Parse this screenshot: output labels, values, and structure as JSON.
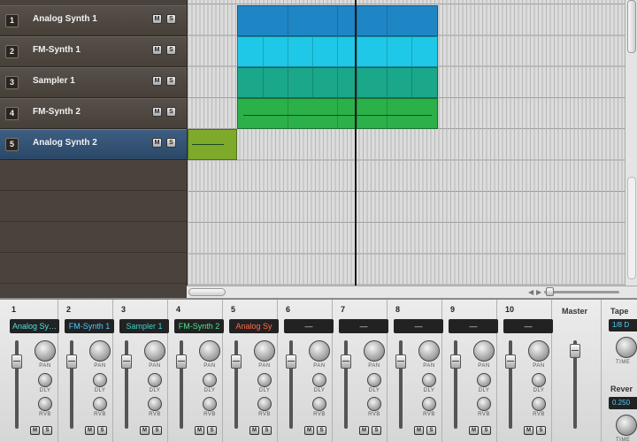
{
  "tracks": [
    {
      "num": "1",
      "name": "Analog Synth 1",
      "mute": "M",
      "solo": "S"
    },
    {
      "num": "2",
      "name": "FM-Synth 1",
      "mute": "M",
      "solo": "S"
    },
    {
      "num": "3",
      "name": "Sampler 1",
      "mute": "M",
      "solo": "S"
    },
    {
      "num": "4",
      "name": "FM-Synth 2",
      "mute": "M",
      "solo": "S"
    },
    {
      "num": "5",
      "name": "Analog Synth 2",
      "mute": "M",
      "solo": "S"
    }
  ],
  "clip_colors": {
    "track1": "#1f86c6",
    "track2": "#1fc8e6",
    "track3": "#1aa78a",
    "track4": "#2bb04a",
    "track5": "#7daa2a"
  },
  "mixer": {
    "strips": [
      {
        "num": "1",
        "name": "Analog Sy…"
      },
      {
        "num": "2",
        "name": "FM-Synth 1"
      },
      {
        "num": "3",
        "name": "Sampler 1"
      },
      {
        "num": "4",
        "name": "FM-Synth 2"
      },
      {
        "num": "5",
        "name": "Analog Sy"
      },
      {
        "num": "6",
        "name": "—"
      },
      {
        "num": "7",
        "name": "—"
      },
      {
        "num": "8",
        "name": "—"
      },
      {
        "num": "9",
        "name": "—"
      },
      {
        "num": "10",
        "name": "—"
      }
    ],
    "knob_labels": {
      "pan": "PAN",
      "dly": "DLY",
      "rvb": "RVB"
    },
    "mute": "M",
    "solo": "S",
    "master": "Master"
  },
  "fx": {
    "tape_title": "Tape",
    "tape_value": "1/8 D",
    "reverb_title": "Rever",
    "reverb_value": "0.250",
    "time_label": "TIME"
  }
}
